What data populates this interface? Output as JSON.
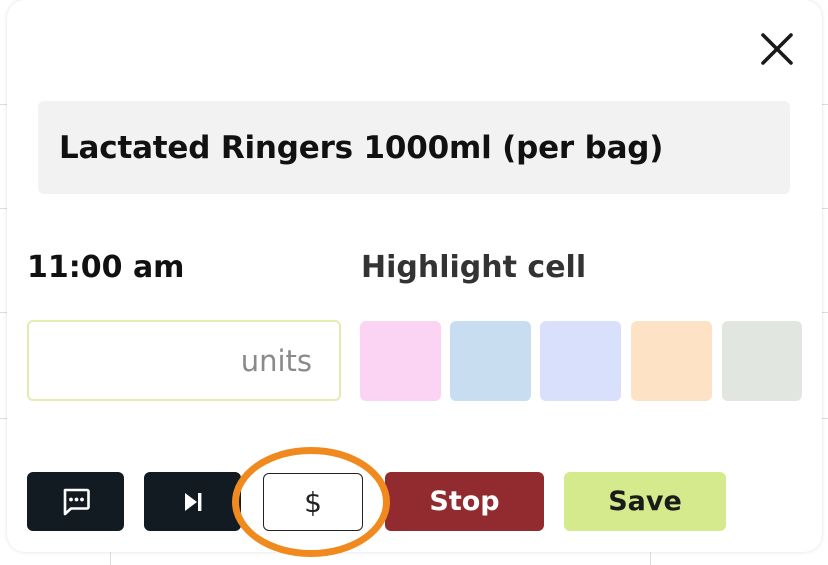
{
  "item": {
    "title": "Lactated Ringers 1000ml (per bag)"
  },
  "time": {
    "label": "11:00 am"
  },
  "units_input": {
    "value": "",
    "placeholder": "units"
  },
  "highlight": {
    "label": "Highlight cell",
    "swatches": [
      {
        "name": "pink",
        "color": "#fad4f2"
      },
      {
        "name": "blue",
        "color": "#c8ddf0"
      },
      {
        "name": "lavender",
        "color": "#d8e0fb"
      },
      {
        "name": "peach",
        "color": "#fde2c6"
      },
      {
        "name": "gray-green",
        "color": "#e1e6e1"
      }
    ]
  },
  "actions": {
    "comment_icon": "comment-icon",
    "skip_icon": "skip-next-icon",
    "billing_symbol": "$",
    "stop_label": "Stop",
    "save_label": "Save"
  },
  "colors": {
    "dark_button": "#131b22",
    "stop_button": "#922b2f",
    "save_button": "#d5ea8c",
    "annotation_ring": "#f08a1f"
  }
}
